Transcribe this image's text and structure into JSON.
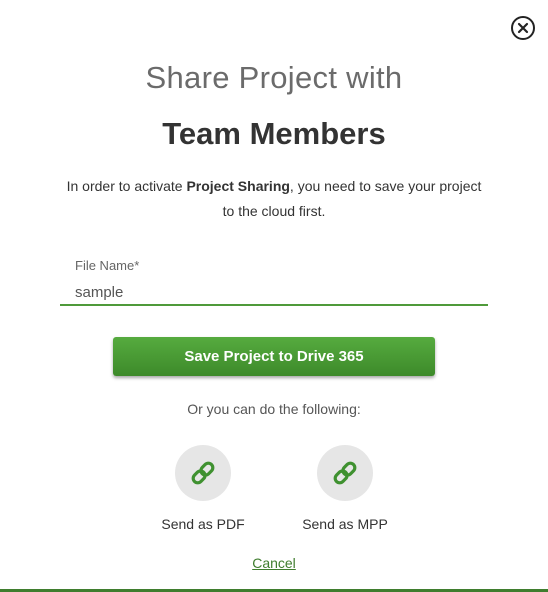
{
  "dialog": {
    "close_icon": "close-circle-icon",
    "title_line1": "Share Project with",
    "title_line2": "Team Members",
    "intro_prefix": "In order to activate ",
    "intro_bold": "Project Sharing",
    "intro_suffix": ", you need to save your project to the cloud first."
  },
  "file_name": {
    "label": "File Name*",
    "value": "sample"
  },
  "save_button": {
    "label": "Save Project to Drive 365"
  },
  "alternatives": {
    "text": "Or you can do the following:",
    "options": [
      {
        "label": "Send as PDF",
        "icon": "link-icon"
      },
      {
        "label": "Send as MPP",
        "icon": "link-icon"
      }
    ]
  },
  "cancel": {
    "label": "Cancel"
  },
  "colors": {
    "accent": "#4f9a3a",
    "button_top": "#56ab3f",
    "button_bottom": "#3d8a2a",
    "icon_bg": "#e6e6e6",
    "title_gray": "#6b6b6b"
  }
}
